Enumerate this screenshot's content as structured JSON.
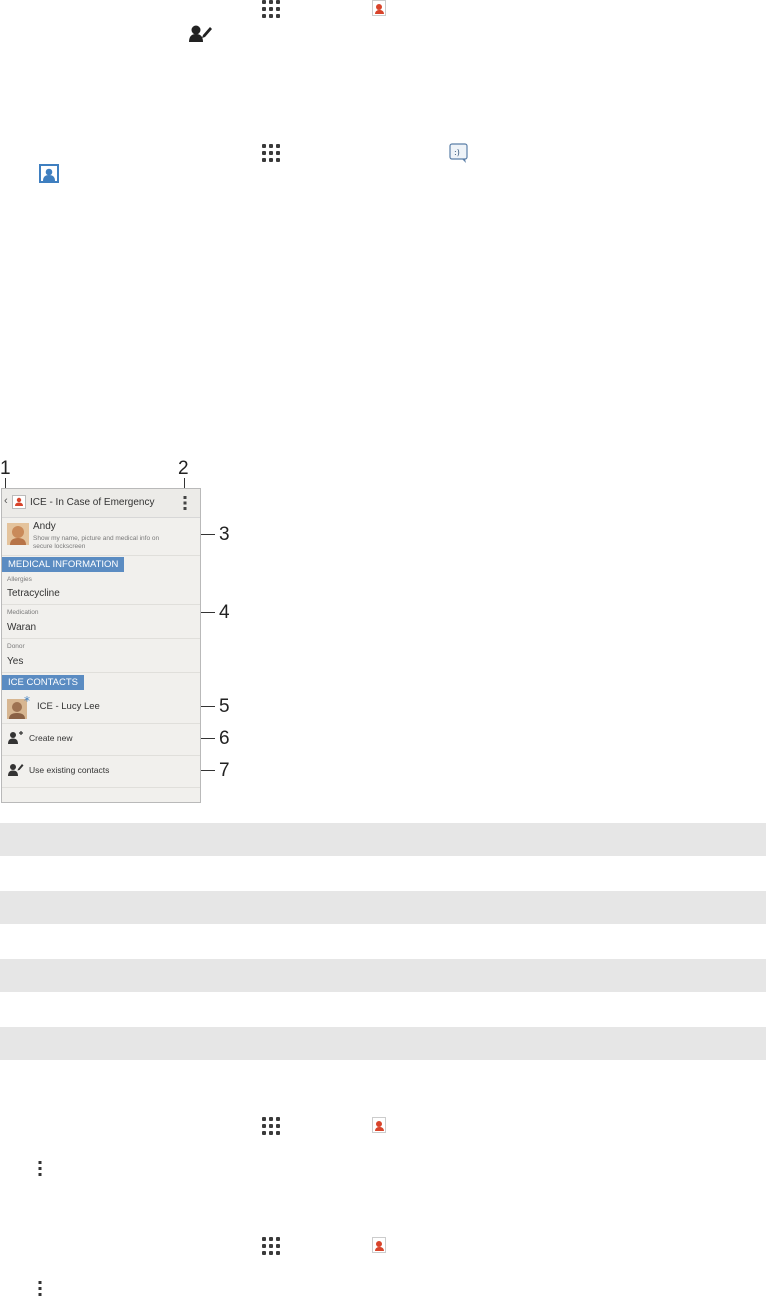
{
  "phone": {
    "title": "ICE - In Case of Emergency",
    "owner_name": "Andy",
    "owner_desc_1": "Show my name, picture and medical info on",
    "owner_desc_2": "secure lockscreen",
    "medical_header": "MEDICAL INFORMATION",
    "fields": [
      {
        "label": "Allergies",
        "value": "Tetracycline"
      },
      {
        "label": "Medication",
        "value": "Waran"
      },
      {
        "label": "Donor",
        "value": "Yes"
      }
    ],
    "ice_header": "ICE CONTACTS",
    "contact": "ICE - Lucy Lee",
    "create_new": "Create new",
    "use_existing": "Use existing contacts"
  },
  "callouts": [
    "1",
    "2",
    "3",
    "4",
    "5",
    "6",
    "7"
  ],
  "colors": {
    "section_header": "#5b8cc2",
    "contact_accent": "#d8442b",
    "table_band": "#e6e6e6"
  }
}
